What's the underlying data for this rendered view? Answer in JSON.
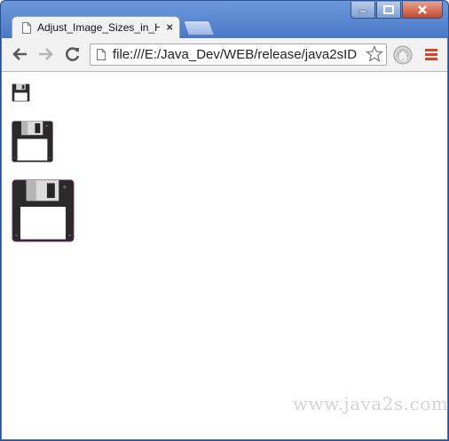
{
  "window": {
    "controls": {
      "minimize_icon": "minimize-icon",
      "maximize_icon": "maximize-icon",
      "close_icon": "close-icon"
    }
  },
  "tab": {
    "title": "Adjust_Image_Sizes_in_HT",
    "close": "×"
  },
  "toolbar": {
    "url": "file:///E:/Java_Dev/WEB/release/java2sID",
    "icons": [
      "back-icon",
      "forward-icon",
      "reload-icon",
      "page-icon",
      "star-icon",
      "extension-icon",
      "menu-icon"
    ]
  },
  "content": {
    "images": [
      {
        "icon": "floppy-disk-icon",
        "size": "small"
      },
      {
        "icon": "floppy-disk-icon",
        "size": "medium"
      },
      {
        "icon": "floppy-disk-icon",
        "size": "large"
      }
    ],
    "watermark": "www.java2s.com"
  },
  "colors": {
    "titlebar": "#4c7ac6",
    "toolbar": "#f2f2f2",
    "menu_accent": "#d9412a"
  }
}
